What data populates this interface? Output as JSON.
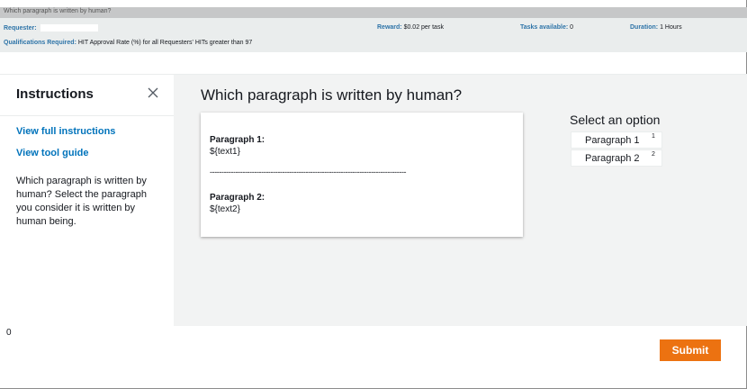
{
  "header": {
    "title": "Which paragraph is written by human?",
    "requester_label": "Requester:",
    "reward_label": "Reward:",
    "reward_value": "$0.02 per task",
    "tasks_label": "Tasks available:",
    "tasks_value": "0",
    "duration_label": "Duration:",
    "duration_value": "1 Hours",
    "quals_label": "Qualifications Required:",
    "quals_value": "HIT Approval Rate (%) for all Requesters' HITs greater than 97"
  },
  "sidebar": {
    "title": "Instructions",
    "close_icon": "close-icon",
    "links": [
      "View full instructions",
      "View tool guide"
    ],
    "description": "Which paragraph is written by human? Select the paragraph you consider it is written by human being."
  },
  "main": {
    "title": "Which paragraph is written by human?",
    "paragraph1_label": "Paragraph 1:",
    "paragraph1_text": "${text1}",
    "separator": "------------------------------------------------------------------------------------",
    "paragraph2_label": "Paragraph 2:",
    "paragraph2_text": "${text2}"
  },
  "options": {
    "heading": "Select an option",
    "items": [
      {
        "label": "Paragraph 1",
        "key": "1"
      },
      {
        "label": "Paragraph 2",
        "key": "2"
      }
    ]
  },
  "footer": {
    "counter": "0",
    "submit_label": "Submit",
    "submit_color": "#ec7211"
  }
}
